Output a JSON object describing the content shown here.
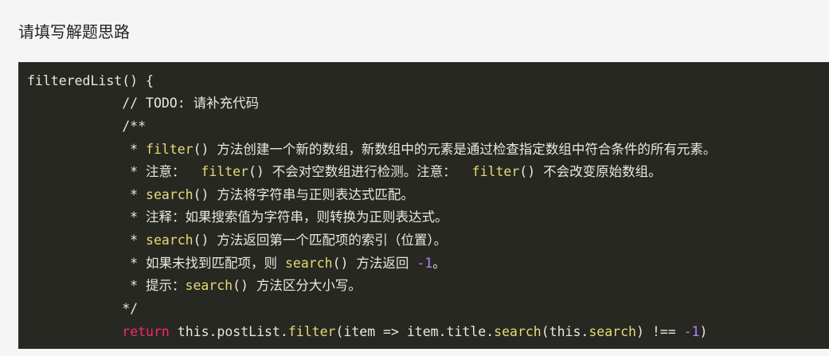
{
  "section": {
    "title": "请填写解题思路"
  },
  "code": {
    "line1": {
      "text": "filteredList() {"
    },
    "line2": {
      "text": "            // TODO: 请补充代码"
    },
    "line3": {
      "text": "            /**"
    },
    "line4": {
      "prefix": "             * ",
      "fn": "filter",
      "rest": "() 方法创建一个新的数组，新数组中的元素是通过检查指定数组中符合条件的所有元素。"
    },
    "line5": {
      "prefix": "             * 注意：  ",
      "fn1": "filter",
      "mid": "() 不会对空数组进行检测。注意：  ",
      "fn2": "filter",
      "rest": "() 不会改变原始数组。"
    },
    "line6": {
      "prefix": "             * ",
      "fn": "search",
      "rest": "() 方法将字符串与正则表达式匹配。"
    },
    "line7": {
      "text": "             * 注释：如果搜索值为字符串，则转换为正则表达式。"
    },
    "line8": {
      "prefix": "             * ",
      "fn": "search",
      "rest": "() 方法返回第一个匹配项的索引（位置）。"
    },
    "line9": {
      "prefix": "             * 如果未找到匹配项，则 ",
      "fn": "search",
      "mid": "() 方法返回 ",
      "num": "-1",
      "rest": "。"
    },
    "line10": {
      "prefix": "             * 提示：",
      "fn": "search",
      "rest": "() 方法区分大小写。"
    },
    "line11": {
      "text": "            */"
    },
    "line12": {
      "indent": "            ",
      "kw": "return",
      "t1": " this.postList.",
      "fn1": "filter",
      "t2": "(item => item.title.",
      "fn2": "search",
      "t3": "(this.",
      "fn3": "search",
      "t4": ") !== ",
      "num": "-1",
      "t5": ")"
    }
  },
  "colors": {
    "code_background": "#272822",
    "code_text": "#e8e8e2",
    "function_name": "#e6db74",
    "keyword": "#f92672",
    "number": "#ae81ff"
  }
}
